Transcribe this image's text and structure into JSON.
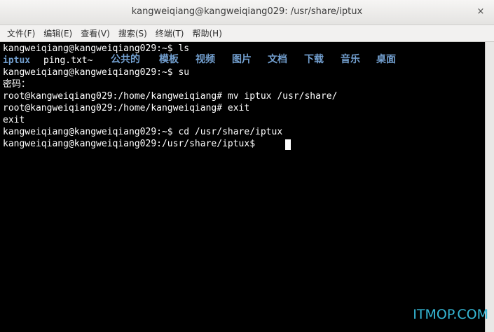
{
  "window": {
    "title": "kangweiqiang@kangweiqiang029: /usr/share/iptux",
    "close_glyph": "×"
  },
  "menu": {
    "items": [
      "文件(F)",
      "编辑(E)",
      "查看(V)",
      "搜索(S)",
      "终端(T)",
      "帮助(H)"
    ]
  },
  "terminal": {
    "background_color": "#000000",
    "text_color": "#ffffff",
    "directory_color": "#729fcf",
    "lines": {
      "l1": "kangweiqiang@kangweiqiang029:~$ ls",
      "l3": "kangweiqiang@kangweiqiang029:~$ su",
      "l4": "密码：",
      "l5": "root@kangweiqiang029:/home/kangweiqiang# mv iptux /usr/share/",
      "l6": "root@kangweiqiang029:/home/kangweiqiang# exit",
      "l7": "exit",
      "l8": "kangweiqiang@kangweiqiang029:~$ cd /usr/share/iptux",
      "l9": "kangweiqiang@kangweiqiang029:/usr/share/iptux$ "
    },
    "ls_output": [
      "iptux",
      "ping.txt~",
      "公共的",
      "模板",
      "视频",
      "图片",
      "文档",
      "下载",
      "音乐",
      "桌面"
    ]
  },
  "watermark": {
    "text": "ITMOP.COM"
  }
}
